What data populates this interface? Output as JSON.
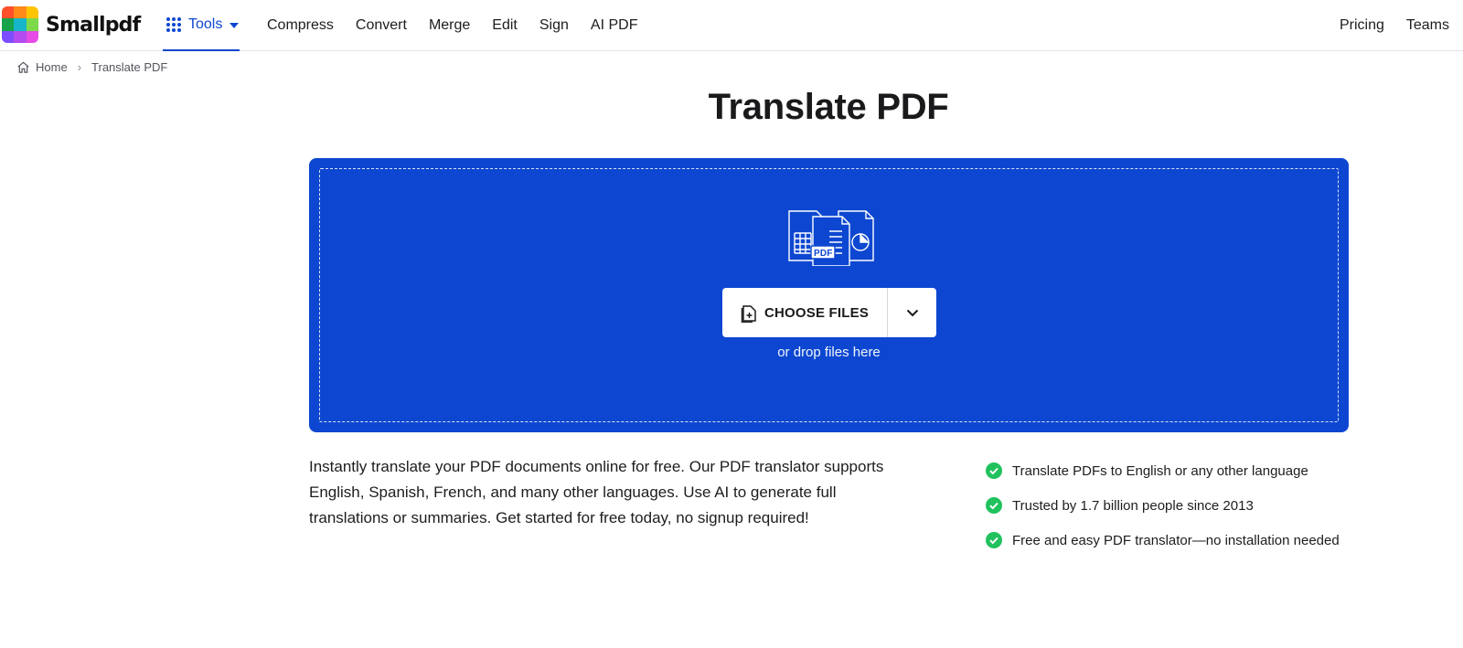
{
  "brand": {
    "name": "Smallpdf"
  },
  "header": {
    "tools_label": "Tools",
    "nav": [
      "Compress",
      "Convert",
      "Merge",
      "Edit",
      "Sign",
      "AI PDF"
    ],
    "right_nav": [
      "Pricing",
      "Teams"
    ]
  },
  "breadcrumb": {
    "home": "Home",
    "current": "Translate PDF"
  },
  "page": {
    "title": "Translate PDF"
  },
  "dropzone": {
    "choose_label": "CHOOSE FILES",
    "hint": "or drop files here",
    "doc_badge": "PDF"
  },
  "description": "Instantly translate your PDF documents online for free. Our PDF translator supports English, Spanish, French, and many other languages. Use AI to generate full translations or summaries. Get started for free today, no signup required!",
  "features": [
    "Translate PDFs to English or any other language",
    "Trusted by 1.7 billion people since 2013",
    "Free and easy PDF translator—no installation needed"
  ],
  "colors": {
    "brand_blue": "#0d47d1",
    "check_green": "#21c25e",
    "text": "#1d1d1f"
  },
  "icons": {
    "logo": "smallpdf-logo-icon",
    "tools": "grid-dots-icon",
    "home": "home-icon",
    "choose": "file-add-icon",
    "dropdown": "chevron-down-icon",
    "feature": "check-circle-icon"
  }
}
